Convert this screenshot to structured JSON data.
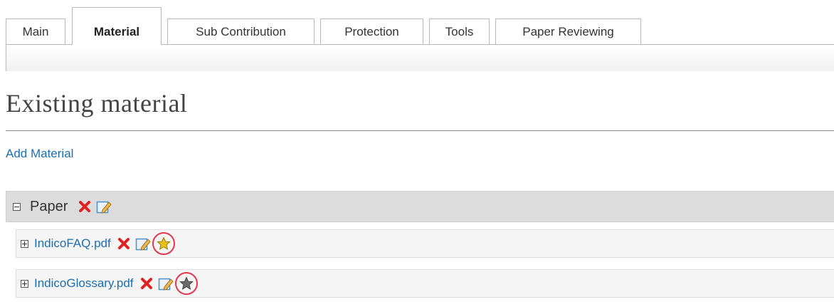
{
  "tabs": {
    "main": "Main",
    "material": "Material",
    "sub_contribution": "Sub Contribution",
    "protection": "Protection",
    "tools": "Tools",
    "paper_reviewing": "Paper Reviewing",
    "active": "Material"
  },
  "page": {
    "title": "Existing material",
    "add_material_label": "Add Material"
  },
  "materials": {
    "group_label": "Paper",
    "group_expanded": true,
    "files": [
      {
        "name": "IndicoFAQ.pdf",
        "main_resource": true,
        "star_color": "#e8c21a"
      },
      {
        "name": "IndicoGlossary.pdf",
        "main_resource": false,
        "star_color": "#6b6b6b"
      }
    ]
  },
  "colors": {
    "link": "#1a6fb5",
    "delete_icon": "#e02020",
    "highlight_circle": "#e0394f",
    "group_row_bg": "#dcdcdc"
  }
}
